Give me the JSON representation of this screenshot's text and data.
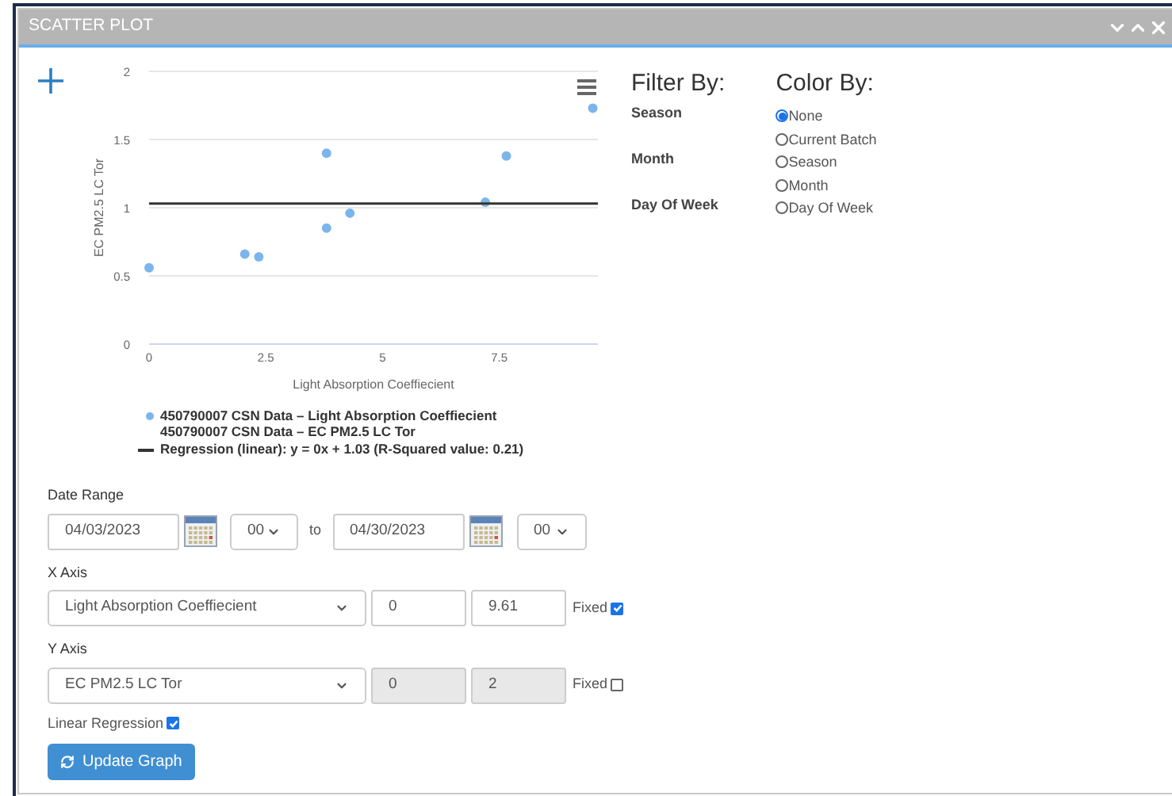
{
  "panel": {
    "title": "SCATTER PLOT"
  },
  "chart": {
    "chart_data": {
      "type": "scatter",
      "xlabel": "Light Absorption Coeffiecient",
      "ylabel": "EC PM2.5 LC Tor",
      "xlim": [
        0,
        9.61
      ],
      "ylim": [
        0,
        2
      ],
      "grid": true,
      "legend": "bottom",
      "xticks": [
        {
          "value": 0,
          "label": "0"
        },
        {
          "value": 2.5,
          "label": "2.5"
        },
        {
          "value": 5,
          "label": "5"
        },
        {
          "value": 7.5,
          "label": "7.5"
        }
      ],
      "yticks": [
        {
          "value": 0,
          "label": "0"
        },
        {
          "value": 0.5,
          "label": "0.5"
        },
        {
          "value": 1,
          "label": "1"
        },
        {
          "value": 1.5,
          "label": "1.5"
        },
        {
          "value": 2,
          "label": "2"
        }
      ],
      "series": [
        {
          "name": "450790007 CSN Data – Light Absorption Coeffiecient\n450790007 CSN Data – EC PM2.5 LC Tor",
          "type": "scatter",
          "color": "#7cb5ec",
          "x": [
            0,
            2.05,
            2.35,
            3.8,
            3.8,
            4.3,
            7.2,
            7.65,
            9.5
          ],
          "values": [
            0.56,
            0.66,
            0.64,
            1.4,
            0.85,
            0.96,
            1.04,
            1.38,
            1.73
          ]
        },
        {
          "name": "Regression (linear): y = 0x + 1.03 (R-Squared value: 0.21)",
          "type": "line",
          "color": "#333333",
          "x": [
            0,
            9.61
          ],
          "values": [
            1.03,
            1.03
          ]
        }
      ]
    }
  },
  "filter": {
    "heading": "Filter By:",
    "items": [
      "Season",
      "Month",
      "Day Of Week"
    ]
  },
  "color_by": {
    "heading": "Color By:",
    "options": [
      {
        "label": "None",
        "selected": true
      },
      {
        "label": "Current Batch",
        "selected": false
      },
      {
        "label": "Season",
        "selected": false
      },
      {
        "label": "Month",
        "selected": false
      },
      {
        "label": "Day Of Week",
        "selected": false
      }
    ]
  },
  "date_range": {
    "label": "Date Range",
    "start": "04/03/2023",
    "start_hour": "00",
    "separator": "to",
    "end": "04/30/2023",
    "end_hour": "00"
  },
  "x_axis": {
    "label": "X Axis",
    "variable": "Light Absorption Coeffiecient",
    "min": "0",
    "max": "9.61",
    "fixed_label": "Fixed",
    "fixed": true
  },
  "y_axis": {
    "label": "Y Axis",
    "variable": "EC PM2.5 LC Tor",
    "min": "0",
    "max": "2",
    "fixed_label": "Fixed",
    "fixed": false
  },
  "linear_regression": {
    "label": "Linear Regression",
    "checked": true
  },
  "update_button": "Update Graph"
}
